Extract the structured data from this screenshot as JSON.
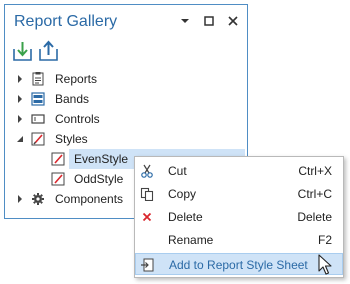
{
  "panel": {
    "title": "Report Gallery",
    "window_buttons": [
      "chevron-down-icon",
      "maximize-icon",
      "close-icon"
    ],
    "toolbar": [
      "import-icon",
      "export-icon"
    ]
  },
  "tree": [
    {
      "label": "Reports",
      "icon": "report-icon",
      "expander": "collapsed"
    },
    {
      "label": "Bands",
      "icon": "bands-icon",
      "expander": "collapsed"
    },
    {
      "label": "Controls",
      "icon": "controls-icon",
      "expander": "collapsed"
    },
    {
      "label": "Styles",
      "icon": "styles-icon",
      "expander": "expanded"
    },
    {
      "label": "EvenStyle",
      "icon": "style-icon",
      "selected": true
    },
    {
      "label": "OddStyle",
      "icon": "style-icon"
    },
    {
      "label": "Components",
      "icon": "gear-icon",
      "expander": "collapsed"
    }
  ],
  "menu": [
    {
      "label": "Cut",
      "shortcut": "Ctrl+X",
      "icon": "cut-icon"
    },
    {
      "label": "Copy",
      "shortcut": "Ctrl+C",
      "icon": "copy-icon"
    },
    {
      "label": "Delete",
      "shortcut": "Delete",
      "icon": "delete-icon"
    },
    {
      "label": "Rename",
      "shortcut": "F2",
      "icon": ""
    },
    {
      "label": "Add to Report Style Sheet",
      "shortcut": "",
      "icon": "add-to-stylesheet-icon",
      "hovered": true
    }
  ],
  "colors": {
    "accent": "#2b6aa6",
    "selection": "#cfe3f7",
    "border": "#4f8dc4",
    "delete": "#d9262c",
    "import_green": "#3aa14a"
  }
}
